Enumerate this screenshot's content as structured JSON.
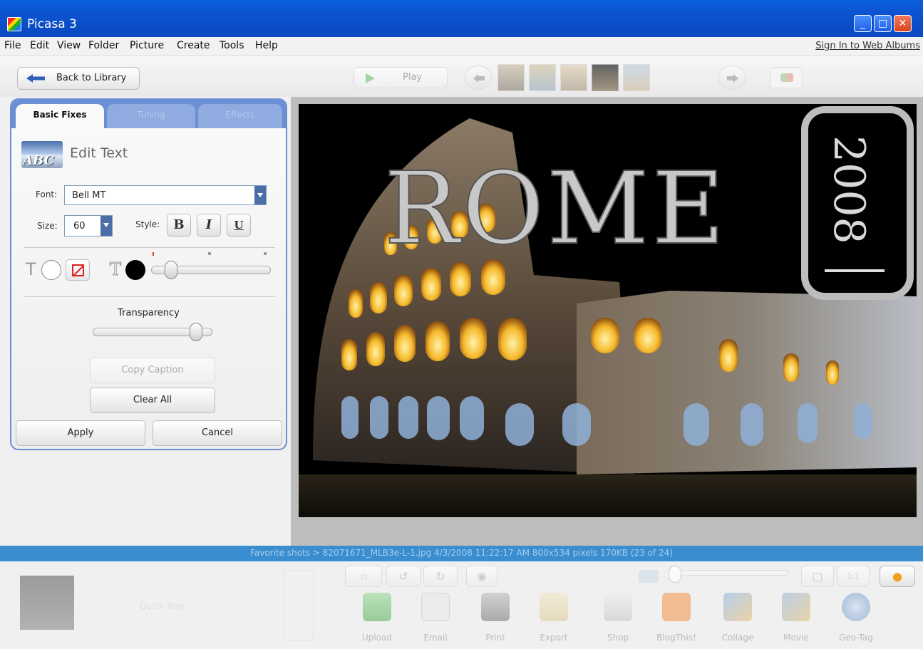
{
  "window": {
    "title": "Picasa 3",
    "controls": {
      "minimize": "_",
      "maximize": "□",
      "close": "✕"
    }
  },
  "menu": {
    "items": [
      "File",
      "Edit",
      "View",
      "Folder",
      "Picture",
      "Create",
      "Tools",
      "Help"
    ],
    "sign_in": "Sign In to Web Albums"
  },
  "toolbar": {
    "back_label": "Back to Library",
    "play_label": "Play"
  },
  "panel": {
    "tabs": [
      "Basic Fixes",
      "Tuning",
      "Effects"
    ],
    "active_tab": "Basic Fixes",
    "abc_icon_text": "ABC",
    "edit_text_title": "Edit Text",
    "font_label": "Font:",
    "font_value": "Bell MT",
    "size_label": "Size:",
    "size_value": "60",
    "style_label": "Style:",
    "style_buttons": {
      "bold": "B",
      "italic": "I",
      "underline": "U"
    },
    "text_color_glyph": "T",
    "outline_color_glyph": "T",
    "transparency_label": "Transparency",
    "transparency_value": 0.9,
    "outline_width_value": 0.1,
    "copy_caption_label": "Copy Caption",
    "clear_all_label": "Clear All",
    "apply_label": "Apply",
    "cancel_label": "Cancel"
  },
  "photo": {
    "title_text": "ROME",
    "year_text": "2008"
  },
  "status": {
    "text": "Favorite shots > 82071671_MLB3e-L-1.jpg    4/3/2008 11:22:17 AM    800x534 pixels    170KB    (23 of 24)"
  },
  "tray": {
    "label": "Quick Tray",
    "actions": [
      "Upload",
      "Email",
      "Print",
      "Export",
      "Shop",
      "BlogThis!",
      "Collage",
      "Movie",
      "Geo-Tag"
    ]
  },
  "colors": {
    "title_bar": "#0a54d0",
    "status_bar": "#3a8ecf",
    "panel_border": "#6a8fd5"
  }
}
